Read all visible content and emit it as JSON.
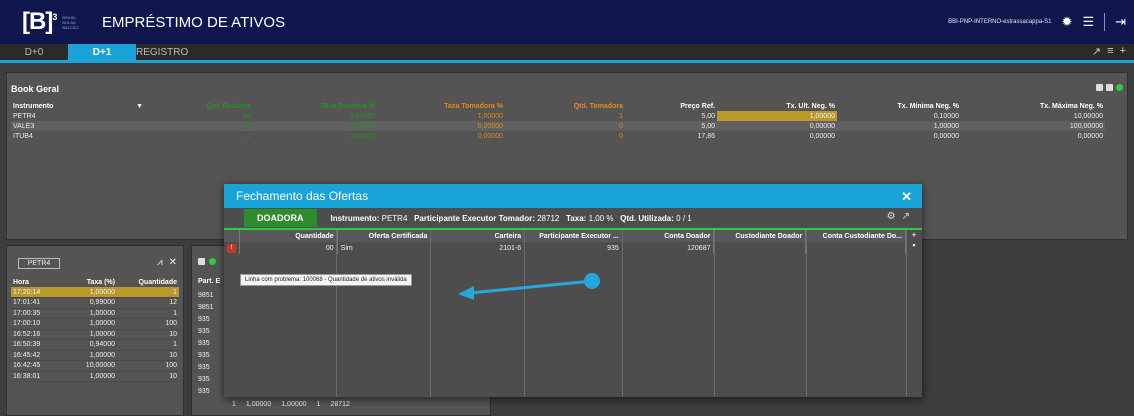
{
  "header": {
    "logo_letter": "[B]",
    "logo_super": "3",
    "logo_sub": [
      "BRASIL",
      "BOLSA",
      "BALCÃO"
    ],
    "title": "EMPRÉSTIMO DE ATIVOS",
    "user": "BBI-PNP-INTERNO-estrassacappa-S1",
    "icons": [
      "gear-icon",
      "menu-icon",
      "logout-icon"
    ]
  },
  "tabs": [
    {
      "label": "D+0"
    },
    {
      "label": "D+1"
    },
    {
      "label": "REGISTRO"
    }
  ],
  "book": {
    "title": "Book Geral",
    "columns": [
      "Instrumento",
      "Qtd. Doadora",
      "Taxa Doadora %",
      "Taxa Tomadora %",
      "Qtd. Tomadora",
      "Preço Ref.",
      "Tx. Ult. Neg. %",
      "Tx. Mínima Neg. %",
      "Tx. Máxima Neg. %"
    ],
    "rows": [
      [
        "PETR4",
        "84",
        "0,94000",
        "1,00000",
        "1",
        "5,00",
        "1,00000",
        "0,10000",
        "10,00000"
      ],
      [
        "VALE3",
        "10",
        "1,00000",
        "0,00000",
        "0",
        "5,00",
        "0,00000",
        "1,00000",
        "100,00000"
      ],
      [
        "ITUB4",
        "0",
        "0,00000",
        "0,00000",
        "0",
        "17,86",
        "0,00000",
        "0,00000",
        "0,00000"
      ]
    ]
  },
  "history": {
    "instrument": "PETR4",
    "columns": [
      "Hora",
      "Taxa (%)",
      "Quantidade"
    ],
    "rows": [
      [
        "17:20:14",
        "1,00000",
        "1"
      ],
      [
        "17:01:41",
        "0,99000",
        "12"
      ],
      [
        "17:00:35",
        "1,00000",
        "1"
      ],
      [
        "17:00:10",
        "1,00000",
        "100"
      ],
      [
        "16:52:16",
        "1,00000",
        "10"
      ],
      [
        "16:50:39",
        "0,94000",
        "1"
      ],
      [
        "16:45:42",
        "1,00000",
        "10"
      ],
      [
        "16:42:45",
        "10,00000",
        "100"
      ],
      [
        "16:38:01",
        "1,00000",
        "10"
      ]
    ]
  },
  "orders": {
    "column": "Part. E",
    "values": [
      "9851",
      "9851",
      "935",
      "935",
      "935",
      "935",
      "935",
      "935",
      "935"
    ],
    "bottom_row": [
      "1",
      "1,00000",
      "1,00000",
      "1",
      "28712"
    ]
  },
  "modal": {
    "title": "Fechamento das Ofertas",
    "side": "DOADORA",
    "instrument_label": "Instrumento:",
    "instrument": "PETR4",
    "participant_label": "Participante Executor Tomador:",
    "participant": "28712",
    "rate_label": "Taxa:",
    "rate": "1,00 %",
    "qty_label": "Qtd. Utilizada:",
    "qty": "0 / 1",
    "columns": [
      "Quantidade",
      "Oferta Certificada",
      "Carteira",
      "Participante Executor ...",
      "Conta Doador",
      "Custodiante Doador",
      "Conta Custodiante Do..."
    ],
    "row": {
      "badge": "!",
      "quantidade": "0",
      "oferta_extra": "0",
      "oferta": "Sim",
      "carteira": "2101-6",
      "participante": "935",
      "conta": "120687",
      "custodiante": "",
      "conta_custodiante": ""
    },
    "tooltip": "Linha com problema: 100068 - Quantidade de ativos inválida"
  }
}
